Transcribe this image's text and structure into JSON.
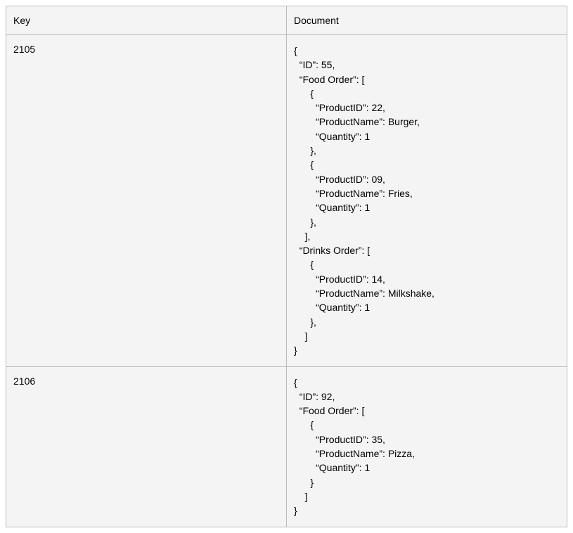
{
  "headers": {
    "key": "Key",
    "document": "Document"
  },
  "rows": [
    {
      "key": "2105",
      "document": "{\n  “ID”: 55,\n  “Food Order”: [\n      {\n        “ProductID”: 22,\n        “ProductName”: Burger,\n        “Quantity”: 1\n      },\n      {\n        “ProductID”: 09,\n        “ProductName”: Fries,\n        “Quantity”: 1\n      },\n    ],\n  “Drinks Order”: [\n      {\n        “ProductID”: 14,\n        “ProductName”: Milkshake,\n        “Quantity”: 1\n      },\n    ]\n}"
    },
    {
      "key": "2106",
      "document": "{\n  “ID”: 92,\n  “Food Order”: [\n      {\n        “ProductID”: 35,\n        “ProductName”: Pizza,\n        “Quantity”: 1\n      }\n    ]\n}"
    }
  ]
}
